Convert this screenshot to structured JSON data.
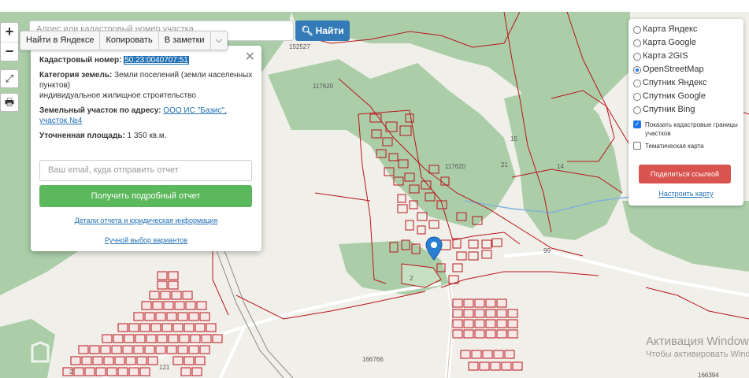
{
  "search": {
    "placeholder": "Адрес или кадастровый номер участка",
    "button_label": "Найти"
  },
  "zoom": {
    "in_label": "+",
    "out_label": "−"
  },
  "action_bar": {
    "find_yandex": "Найти в Яндексе",
    "copy": "Копировать",
    "notes": "В заметки"
  },
  "popup": {
    "cadastral_label": "Кадастровый номер:",
    "cadastral_value": "50:23:0040707:51",
    "category_label": "Категория земель:",
    "category_value": "Земли поселений (земли населенных пунктов)",
    "use_value": "индивидуальное жилищное строительство",
    "address_label": "Земельный участок по адресу:",
    "address_value": "ООО ИС \"Базис\", участок №4",
    "area_label": "Уточненная площадь:",
    "area_value": "1 350 кв.м.",
    "email_placeholder": "Ваш email, куда отправить отчет",
    "report_button": "Получить подробный отчет",
    "details_link": "Детали отчета и юридическая информация",
    "manual_link": "Ручной выбор вариантов"
  },
  "layers": {
    "options": [
      {
        "label": "Карта Яндекс",
        "selected": false
      },
      {
        "label": "Карта Google",
        "selected": false
      },
      {
        "label": "Карта 2GIS",
        "selected": false
      },
      {
        "label": "OpenStreetMap",
        "selected": true
      },
      {
        "label": "Спутник Яндекс",
        "selected": false
      },
      {
        "label": "Спутник Google",
        "selected": false
      },
      {
        "label": "Спутник Bing",
        "selected": false
      }
    ],
    "show_borders": "Показать кадастровые границы участков",
    "show_borders_checked": true,
    "thematic": "Тематическая карта",
    "thematic_checked": false,
    "share_button": "Поделиться ссылкой",
    "configure_link": "Настроить карту"
  },
  "map_labels": {
    "l1": "152527",
    "l2": "117620",
    "l3": "117620",
    "l4": "15",
    "l5": "21",
    "l6": "14",
    "l7": "99",
    "l8": "2",
    "l9": "121",
    "l10": "166766",
    "l11": "2",
    "l12": "166394"
  },
  "watermark": "Активация Windows",
  "watermark_sub": "Чтобы активировать Windows",
  "colors": {
    "map_bg": "#f1efe9",
    "forest": "#abcea9",
    "parcel": "#b8141c",
    "primary": "#337ab7",
    "success": "#5cb85c",
    "danger": "#d9534f"
  }
}
